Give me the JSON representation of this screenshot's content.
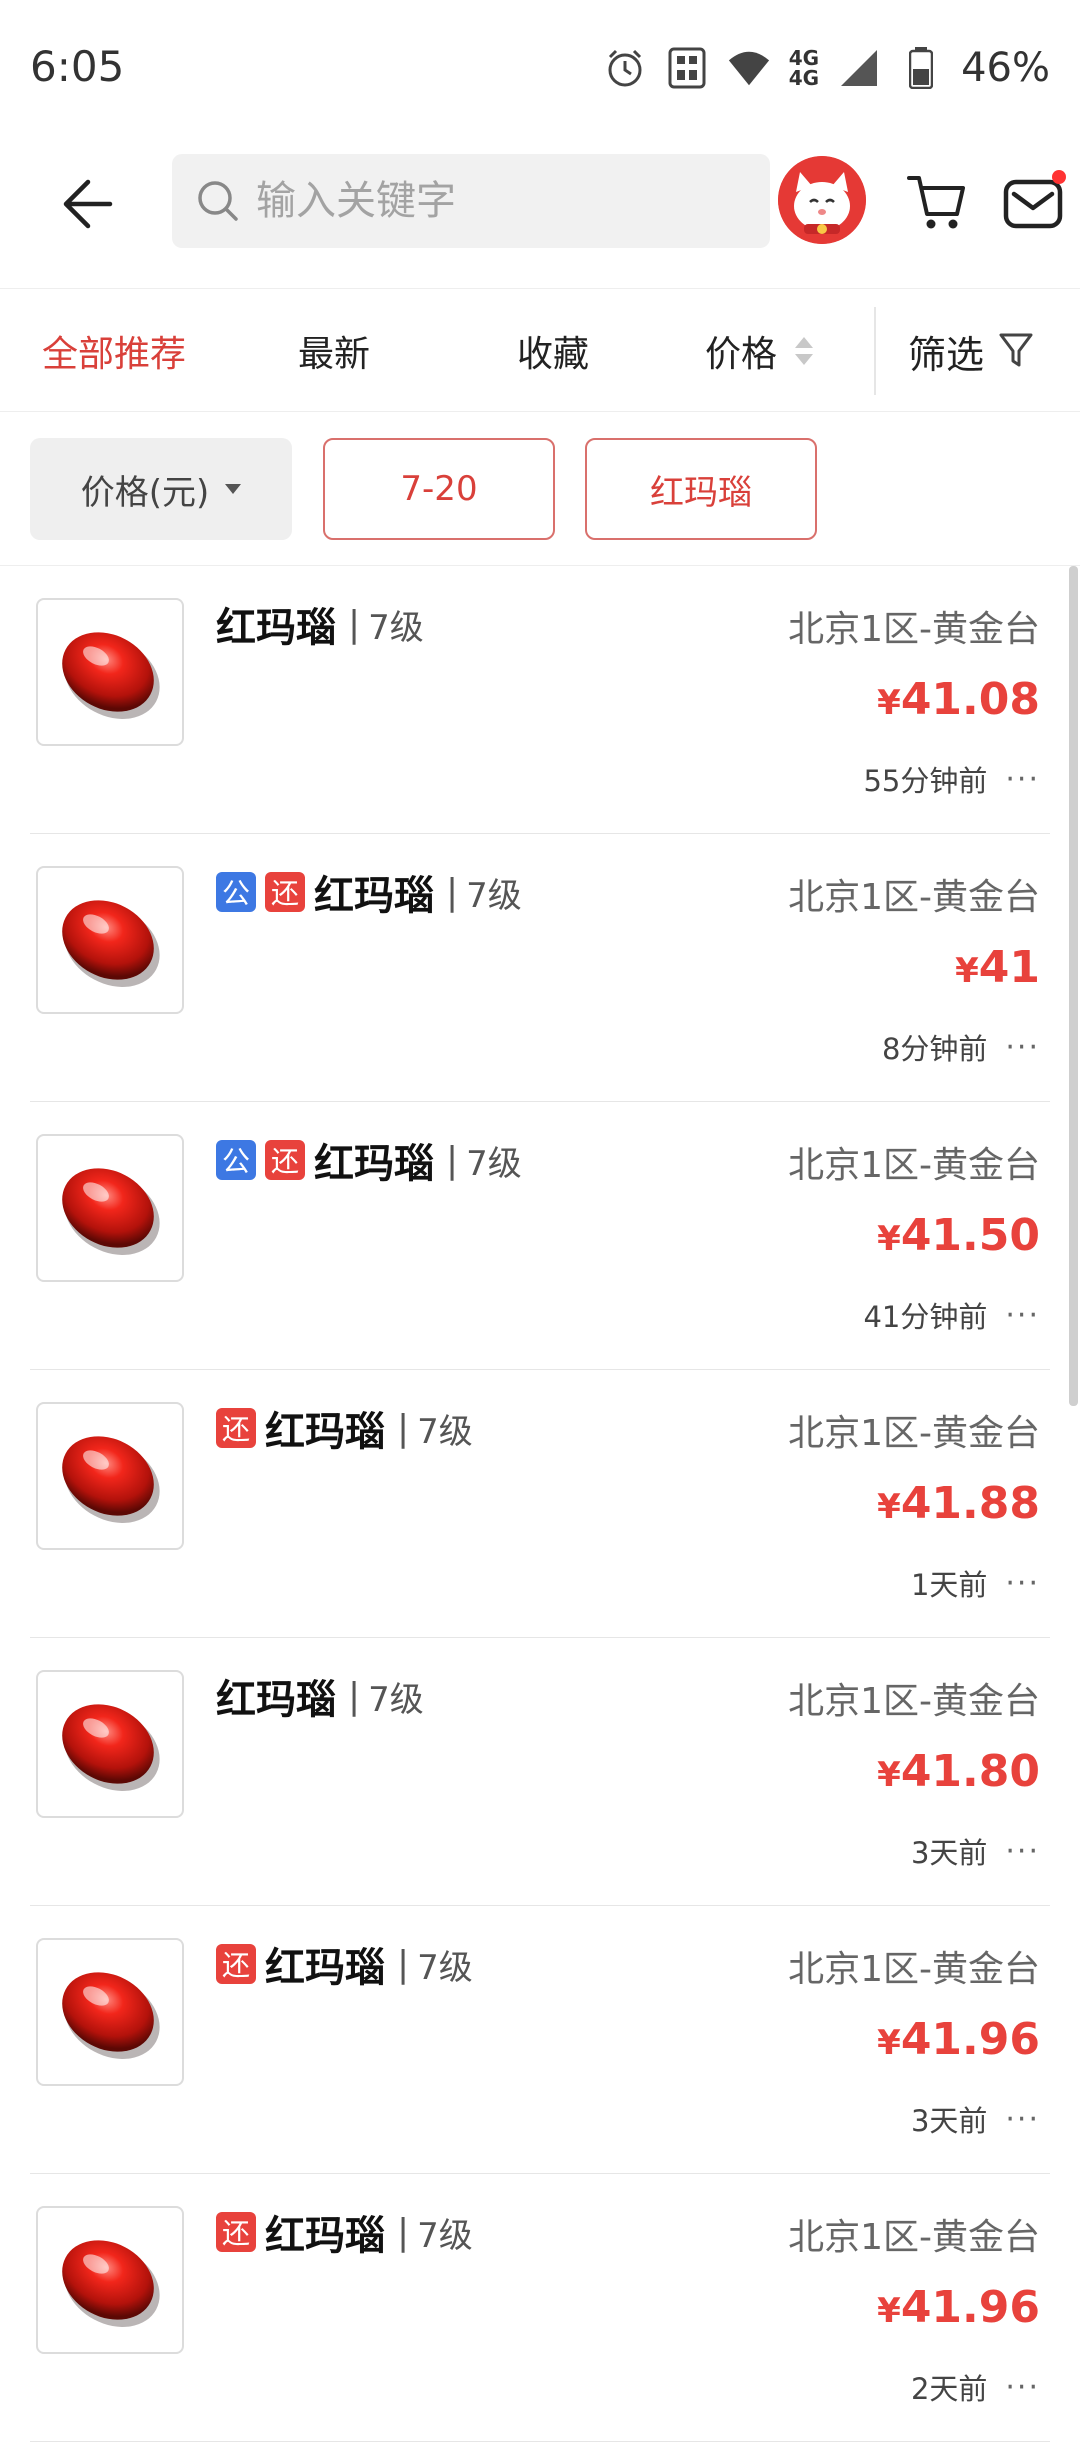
{
  "status_bar": {
    "time": "6:05",
    "net_top": "4G",
    "net_bottom": "4G",
    "battery": "46%"
  },
  "header": {
    "search_placeholder": "输入关键字"
  },
  "sort_tabs": [
    {
      "label": "全部推荐",
      "active": true
    },
    {
      "label": "最新"
    },
    {
      "label": "收藏"
    },
    {
      "label": "价格"
    }
  ],
  "filter_label": "筛选",
  "chips": {
    "price_label": "价格(元)",
    "range": "7-20",
    "keyword": "红玛瑙"
  },
  "colors": {
    "accent_red": "#e8423c",
    "badge_blue": "#3d78e3",
    "active_tab": "#d9403a"
  },
  "listings": [
    {
      "badges": [],
      "name": "红玛瑙",
      "level": "7级",
      "server": "北京1区-黄金台",
      "price": "41.08",
      "time": "55分钟前"
    },
    {
      "badges": [
        "公",
        "还"
      ],
      "name": "红玛瑙",
      "level": "7级",
      "server": "北京1区-黄金台",
      "price": "41",
      "time": "8分钟前"
    },
    {
      "badges": [
        "公",
        "还"
      ],
      "name": "红玛瑙",
      "level": "7级",
      "server": "北京1区-黄金台",
      "price": "41.50",
      "time": "41分钟前"
    },
    {
      "badges": [
        "还"
      ],
      "name": "红玛瑙",
      "level": "7级",
      "server": "北京1区-黄金台",
      "price": "41.88",
      "time": "1天前"
    },
    {
      "badges": [],
      "name": "红玛瑙",
      "level": "7级",
      "server": "北京1区-黄金台",
      "price": "41.80",
      "time": "3天前"
    },
    {
      "badges": [
        "还"
      ],
      "name": "红玛瑙",
      "level": "7级",
      "server": "北京1区-黄金台",
      "price": "41.96",
      "time": "3天前"
    },
    {
      "badges": [
        "还"
      ],
      "name": "红玛瑙",
      "level": "7级",
      "server": "北京1区-黄金台",
      "price": "41.96",
      "time": "2天前"
    }
  ],
  "currency_symbol": "¥",
  "separator": "|",
  "more_glyph": "···"
}
